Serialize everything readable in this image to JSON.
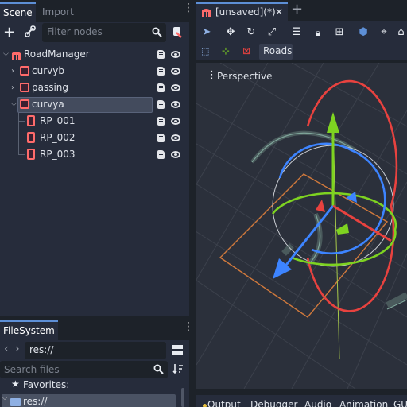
{
  "scene_dock": {
    "tabs": [
      "Scene",
      "Import"
    ],
    "filter_placeholder": "Filter nodes",
    "nodes": [
      {
        "label": "RoadManager"
      },
      {
        "label": "curvyb"
      },
      {
        "label": "passing"
      },
      {
        "label": "curvya"
      },
      {
        "label": "RP_001"
      },
      {
        "label": "RP_002"
      },
      {
        "label": "RP_003"
      }
    ]
  },
  "editor": {
    "tab_title": "[unsaved](*)",
    "close_glyph": "✕",
    "add_glyph": "+",
    "roads_label": "Roads",
    "viewport_menu": "Perspective"
  },
  "filesystem": {
    "tab": "FileSystem",
    "path": "res://",
    "search_placeholder": "Search files",
    "favorites_label": "Favorites:",
    "res_label": "res://"
  },
  "bottom_tabs": [
    "Output",
    "Debugger",
    "Audio",
    "Animation",
    "GU"
  ],
  "colors": {
    "accent": "#5d8fd6",
    "panel": "#262c3b",
    "selection": "#434b5d",
    "axis_x": "#e8423f",
    "axis_y": "#7ed321",
    "axis_z": "#3d84ff"
  }
}
